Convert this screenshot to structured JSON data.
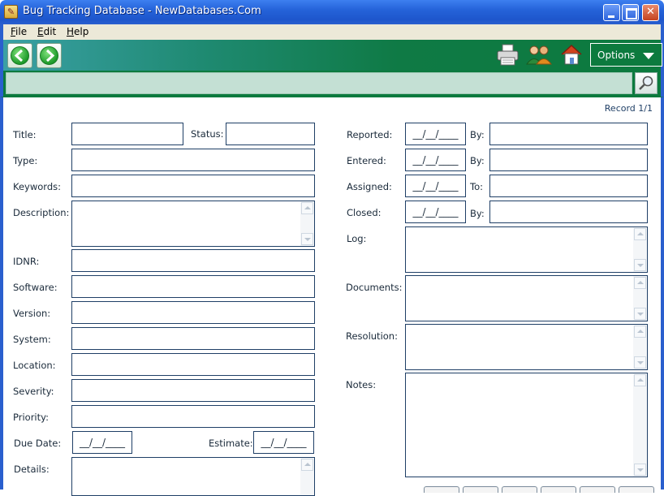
{
  "window": {
    "title": "Bug Tracking Database - NewDatabases.Com",
    "icon": "app-icon"
  },
  "menu": [
    "File",
    "Edit",
    "Help"
  ],
  "toolbar": {
    "back_icon": "back-arrow-icon",
    "forward_icon": "forward-arrow-icon",
    "tools": [
      "printer-icon",
      "users-icon",
      "home-icon"
    ],
    "options_label": "Options"
  },
  "search": {
    "value": "",
    "icon": "search-icon"
  },
  "record_indicator": "Record 1/1",
  "left_fields": {
    "title": "Title:",
    "status": "Status:",
    "type": "Type:",
    "keywords": "Keywords:",
    "description": "Description:",
    "idnr": "IDNR:",
    "software": "Software:",
    "version": "Version:",
    "system": "System:",
    "location": "Location:",
    "severity": "Severity:",
    "priority": "Priority:",
    "due_date": "Due Date:",
    "estimate": "Estimate:",
    "details": "Details:"
  },
  "right_fields": {
    "reported": "Reported:",
    "entered": "Entered:",
    "assigned": "Assigned:",
    "closed": "Closed:",
    "by": "By:",
    "to": "To:",
    "log": "Log:",
    "documents": "Documents:",
    "resolution": "Resolution:",
    "notes": "Notes:"
  },
  "date_placeholder": "__/__/____",
  "colors": {
    "titlebar": "#2563d9",
    "toolbar_green": "#0c7a3e",
    "search_field": "#c4e0d4",
    "field_border": "#1f3f66"
  }
}
